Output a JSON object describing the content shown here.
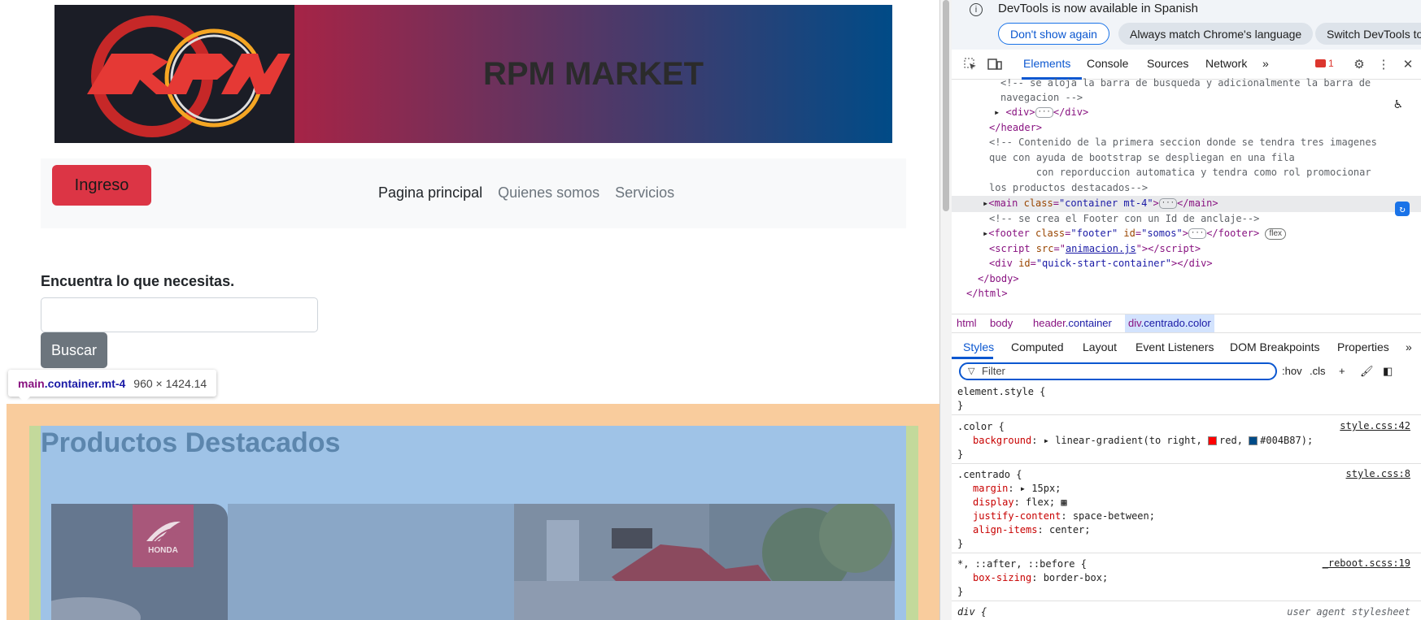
{
  "page": {
    "banner_title": "RPM MARKET",
    "logo_text": "RPM",
    "nav": {
      "login_label": "Ingreso",
      "links": [
        "Pagina principal",
        "Quienes somos",
        "Servicios"
      ]
    },
    "search": {
      "label": "Encuentra lo que necesitas.",
      "placeholder": "",
      "button_label": "Buscar"
    },
    "featured_title": "Productos Destacados",
    "carousel_brand": "HONDA"
  },
  "inspect_tooltip": {
    "tag": "main",
    "classes": ".container.mt-4",
    "size": "960 × 1424.14"
  },
  "devtools": {
    "infobar": {
      "message": "DevTools is now available in Spanish",
      "dont_show": "Don't show again",
      "always_match": "Always match Chrome's language",
      "switch": "Switch DevTools to"
    },
    "tabs": [
      "Elements",
      "Console",
      "Sources",
      "Network"
    ],
    "more_tabs": "»",
    "issues_count": "1",
    "breadcrumbs": {
      "html": "html",
      "body": "body",
      "header_tag": "header",
      "header_cls": ".container",
      "div_tag": "div",
      "div_cls": ".centrado.color"
    },
    "style_tabs": [
      "Styles",
      "Computed",
      "Layout",
      "Event Listeners",
      "DOM Breakpoints",
      "Properties"
    ],
    "filter_placeholder": "Filter",
    "hov": ":hov",
    "cls": ".cls",
    "dom": {
      "l1": "<!-- se aloja la barra de busqueda y adicionalmente la barra de",
      "l2": "navegacion -->",
      "l4": "</header>",
      "l5": "<!-- Contenido de la primera seccion donde se tendra tres imagenes",
      "l6": "que con ayuda de bootstrap se despliegan en una fila",
      "l7": "        con reporduccion automatica y tendra como rol promocionar",
      "l8": "los productos destacados-->",
      "l10": "<!-- se crea el Footer con un Id de anclaje-->",
      "script_src": "animacion.js",
      "quick_start": "\"quick-start-container\"",
      "body_close": "</body>",
      "html_close": "</html>",
      "main_class": "\"container mt-4\"",
      "footer_class": "\"footer\"",
      "footer_id": "\"somos\"",
      "flex": "flex"
    },
    "styles": {
      "element_style": "element.style {",
      "color_selector": ".color {",
      "color_src": "style.css:42",
      "color_prop": "background",
      "color_val_pre": "linear-gradient(to right, ",
      "color_red": "red",
      "color_blue": "#004B87",
      "centrado_selector": ".centrado {",
      "centrado_src": "style.css:8",
      "margin_prop": "margin",
      "margin_val": "15px;",
      "display_prop": "display",
      "display_val": "flex;",
      "justify_prop": "justify-content",
      "justify_val": "space-between;",
      "align_prop": "align-items",
      "align_val": "center;",
      "star_selector": "*, ::after, ::before {",
      "star_src": "_reboot.scss:19",
      "boxsizing_prop": "box-sizing",
      "boxsizing_val": "border-box;",
      "div_selector": "div {",
      "ua": "user agent stylesheet",
      "close_brace": "}"
    }
  },
  "colors": {
    "gradient_start": "#e8142c",
    "gradient_end": "#004B87",
    "login_btn": "#dc3545",
    "devtools_accent": "#0b57d0"
  }
}
